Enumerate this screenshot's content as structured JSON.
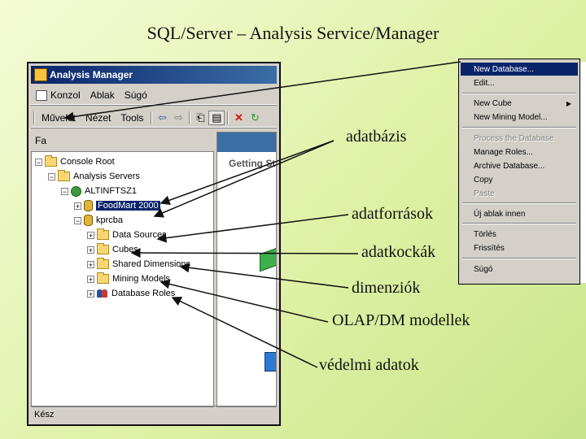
{
  "slide": {
    "title": "SQL/Server – Analysis Service/Manager"
  },
  "window": {
    "title": "Analysis Manager",
    "menubar": [
      "Konzol",
      "Ablak",
      "Súgó"
    ],
    "toolbar_menus": [
      "Művelet",
      "Nézet",
      "Tools"
    ],
    "tree_tab_label": "Fa",
    "right_pane_heading": "Getting St",
    "status_text": "Kész",
    "tree": {
      "console_root": "Console Root",
      "analysis_servers": "Analysis Servers",
      "server": "ALTINFTSZ1",
      "db_foodmart": "FoodMart 2000",
      "db_kprcba": "kprcba",
      "folders": [
        "Data Sources",
        "Cubes",
        "Shared Dimensions",
        "Mining Models",
        "Database Roles"
      ]
    }
  },
  "context_menu": {
    "items": [
      {
        "label": "New Database...",
        "state": "highlight"
      },
      {
        "label": "Edit...",
        "state": "normal"
      },
      {
        "label": "New Cube",
        "state": "normal",
        "submenu": true
      },
      {
        "label": "New Mining Model...",
        "state": "normal"
      },
      {
        "label": "Process the Database",
        "state": "disabled"
      },
      {
        "label": "Manage Roles...",
        "state": "normal"
      },
      {
        "label": "Archive Database...",
        "state": "normal"
      },
      {
        "label": "Copy",
        "state": "normal"
      },
      {
        "label": "Paste",
        "state": "disabled"
      },
      {
        "label": "Új ablak innen",
        "state": "normal"
      },
      {
        "label": "Törlés",
        "state": "normal"
      },
      {
        "label": "Frissítés",
        "state": "normal"
      },
      {
        "label": "Súgó",
        "state": "normal"
      }
    ]
  },
  "callouts": {
    "adatbazis": "adatbázis",
    "adatforrasok": "adatforrások",
    "adatkockak": "adatkockák",
    "dimenziok": "dimenziók",
    "olap": "OLAP/DM modellek",
    "vedelmi": "védelmi adatok"
  },
  "colors": {
    "slide_background": "#dff1a6",
    "selection": "#0a246a",
    "window_chrome": "#d4d0c8"
  }
}
